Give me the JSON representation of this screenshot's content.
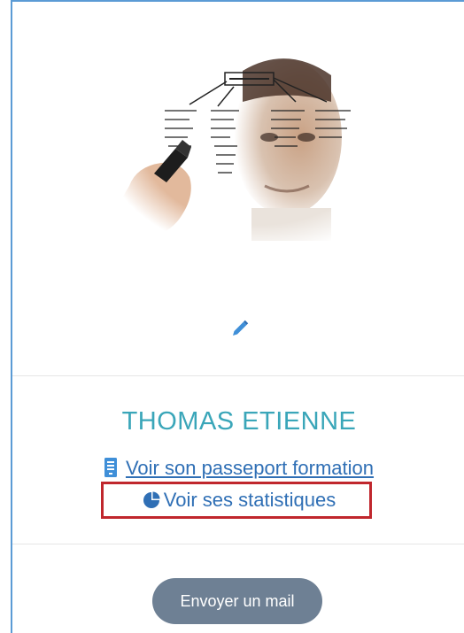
{
  "profile": {
    "name": "THOMAS ETIENNE",
    "photo_icon": "profile-photo-man-writing-diagram",
    "edit_icon": "pencil-icon"
  },
  "links": {
    "passport": {
      "label": "Voir son passeport formation",
      "icon": "document-icon"
    },
    "stats": {
      "label": "Voir ses statistiques",
      "icon": "pie-chart-icon"
    }
  },
  "actions": {
    "mail_label": "Envoyer un mail"
  },
  "colors": {
    "name": "#3aa6b9",
    "link": "#2f6fb5",
    "highlight": "#c0272d",
    "button_bg": "#6e8094",
    "card_border": "#5b9bd5"
  }
}
